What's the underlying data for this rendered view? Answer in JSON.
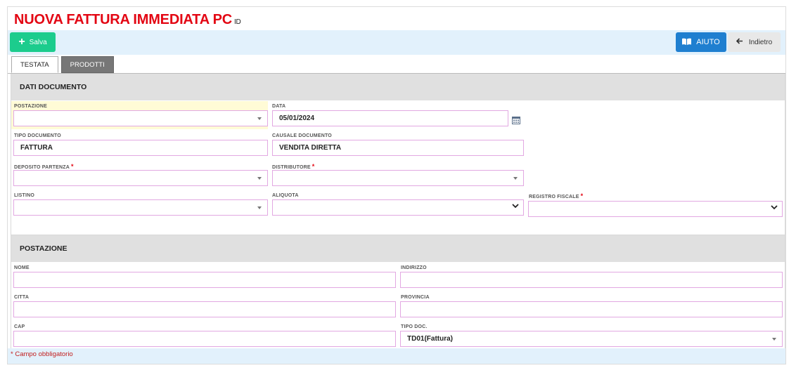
{
  "header": {
    "title": "NUOVA FATTURA IMMEDIATA PC",
    "id_tag": "ID"
  },
  "toolbar": {
    "save_label": "Salva",
    "help_label": "AIUTO",
    "back_label": "Indietro"
  },
  "tabs": [
    {
      "label": "TESTATA",
      "active": true
    },
    {
      "label": "PRODOTTI",
      "active": false
    }
  ],
  "section_documento": {
    "title": "DATI DOCUMENTO",
    "postazione": {
      "label": "POSTAZIONE",
      "value": ""
    },
    "data": {
      "label": "DATA",
      "value": "05/01/2024"
    },
    "tipo_documento": {
      "label": "TIPO DOCUMENTO",
      "value": "FATTURA"
    },
    "causale_documento": {
      "label": "CAUSALE DOCUMENTO",
      "value": "VENDITA DIRETTA"
    },
    "deposito_partenza": {
      "label": "DEPOSITO PARTENZA",
      "required": "*",
      "value": ""
    },
    "distributore": {
      "label": "DISTRIBUTORE",
      "required": "*",
      "value": ""
    },
    "listino": {
      "label": "LISTINO",
      "value": ""
    },
    "aliquota": {
      "label": "ALIQUOTA",
      "value": ""
    },
    "registro_fiscale": {
      "label": "REGISTRO FISCALE",
      "required": "*",
      "value": ""
    }
  },
  "section_postazione": {
    "title": "POSTAZIONE",
    "nome": {
      "label": "NOME",
      "value": ""
    },
    "indirizzo": {
      "label": "INDIRIZZO",
      "value": ""
    },
    "citta": {
      "label": "CITTA",
      "value": ""
    },
    "provincia": {
      "label": "PROVINCIA",
      "value": ""
    },
    "cap": {
      "label": "CAP",
      "value": ""
    },
    "tipo_doc": {
      "label": "TIPO DOC.",
      "value": "TD01(Fattura)"
    }
  },
  "footer": {
    "required_note": "* Campo obbligatorio"
  },
  "colors": {
    "title_red": "#e30613",
    "save_green": "#1ccc8d",
    "help_blue": "#1f7fd0",
    "toolbar_bg": "#e2f1fc",
    "field_border": "#e2a8e2"
  },
  "icons": {
    "save": "plus-icon",
    "help": "book-icon",
    "back": "arrow-left-icon",
    "date": "calendar-icon"
  }
}
